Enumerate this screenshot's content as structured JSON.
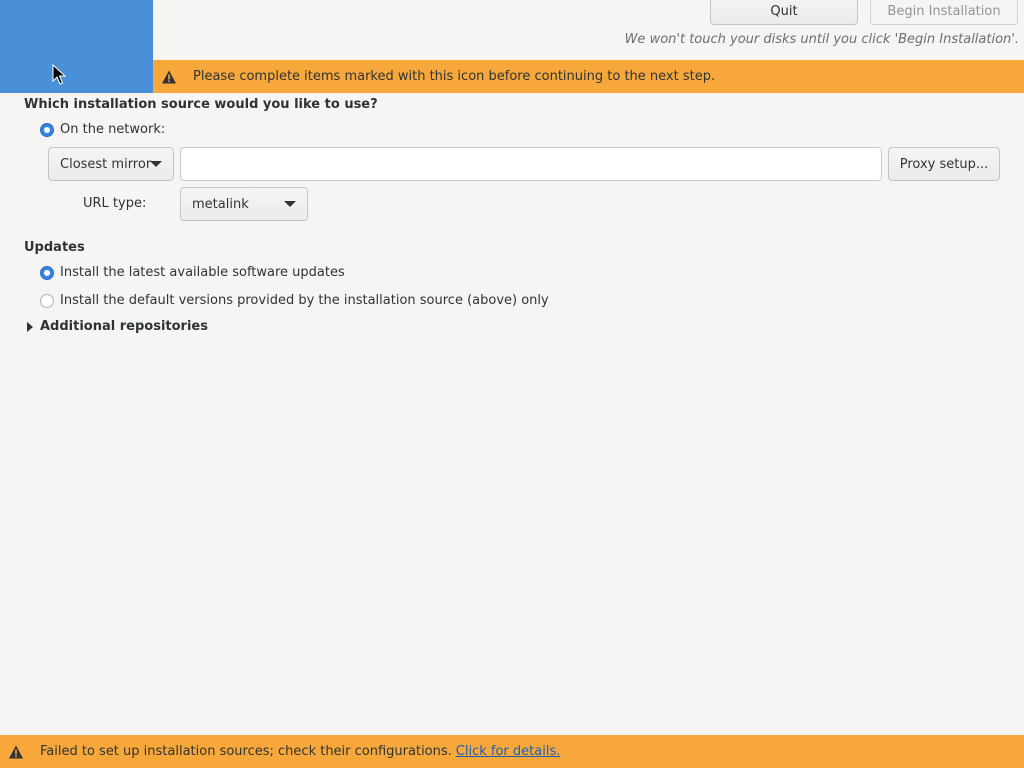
{
  "header": {
    "quit_label": "Quit",
    "begin_label": "Begin Installation",
    "disk_note": "We won't touch your disks until you click 'Begin Installation'."
  },
  "warning_banner": {
    "text": "Please complete items marked with this icon before continuing to the next step.",
    "icon": "warning-icon",
    "color": "#f8a83a"
  },
  "source": {
    "title": "Which installation source would you like to use?",
    "network_label": "On the network:",
    "network_selected": true,
    "mirror_combo_value": "Closest mirror",
    "url_value": "",
    "proxy_button_label": "Proxy setup...",
    "url_type_label": "URL type:",
    "url_type_value": "metalink"
  },
  "updates": {
    "title": "Updates",
    "options": [
      {
        "label": "Install the latest available software updates",
        "selected": true
      },
      {
        "label": "Install the default versions provided by the installation source (above) only",
        "selected": false
      }
    ]
  },
  "additional_repos": {
    "label": "Additional repositories",
    "expanded": false
  },
  "status_bar": {
    "text": "Failed to set up installation sources; check their configurations.",
    "link_text": "Click for details.",
    "icon": "warning-icon"
  },
  "colors": {
    "sidebar_accent": "#4a90d9",
    "warning": "#f8a83a",
    "radio_selected": "#3584e4",
    "link": "#1a5fb4"
  }
}
